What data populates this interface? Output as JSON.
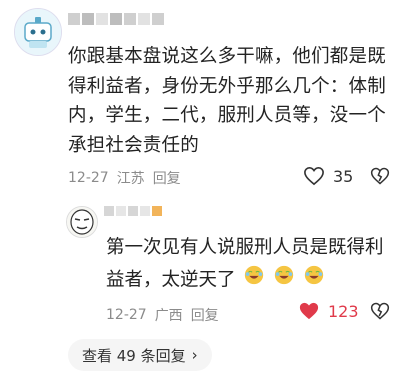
{
  "comment": {
    "text": "你跟基本盘说这么多干嘛，他们都是既得利益者，身份无外乎那么几个：体制内，学生，二代，服刑人员等，没一个承担社会责任的",
    "date": "12-27",
    "location": "江苏",
    "reply_label": "回复",
    "likes": "35"
  },
  "reply": {
    "text": "第一次见有人说服刑人员是既得利益者，太逆天了",
    "date": "12-27",
    "location": "广西",
    "reply_label": "回复",
    "likes": "123"
  },
  "more": {
    "label": "查看 49 条回复",
    "chevron": "›"
  },
  "icons": {
    "like": "heart-outline-icon",
    "liked": "heart-filled-icon",
    "dislike": "broken-heart-icon",
    "laugh": "laughing-crying-emoji"
  },
  "colors": {
    "liked": "#e03a4a",
    "meta": "#8b8b8b"
  }
}
